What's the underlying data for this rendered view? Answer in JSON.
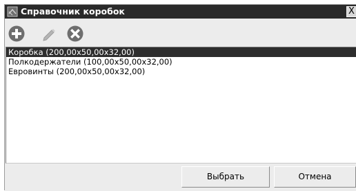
{
  "window": {
    "title": "Справочник коробок",
    "close_label": "X"
  },
  "toolbar": {
    "add_icon": "plus-circle-icon",
    "edit_icon": "pencil-icon",
    "delete_icon": "x-circle-icon"
  },
  "list": {
    "items": [
      "Коробка (200,00x50,00x32,00)",
      "Полкодержатели (100,00x50,00x32,00)",
      "Евровинты (200,00x50,00x32,00)"
    ],
    "selected_index": 0
  },
  "buttons": {
    "select_label": "Выбрать",
    "cancel_label": "Отмена"
  },
  "colors": {
    "title_bg": "#2a2a2a",
    "selection_bg": "#2d2d2d",
    "icon_fill": "#6e6e6e",
    "window_bg": "#ececec"
  }
}
